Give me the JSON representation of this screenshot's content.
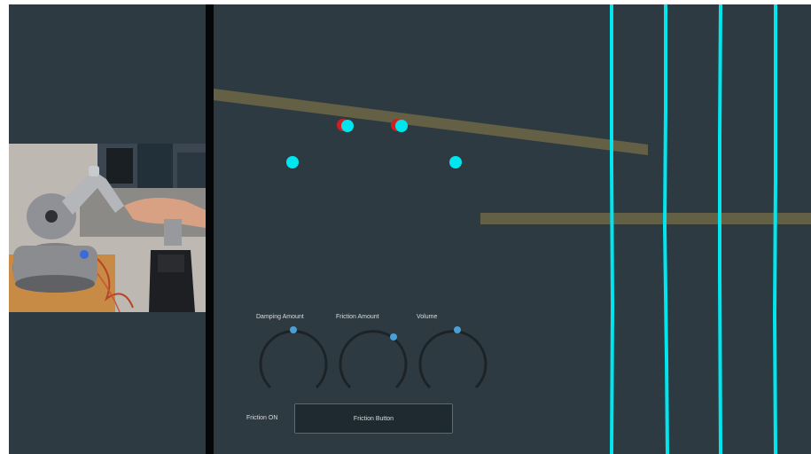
{
  "colors": {
    "background": "#2e3a41",
    "cursor_cyan": "#00e5ee",
    "ghost_red": "#d11f1f",
    "track_gold": "#6a6547",
    "knob_track": "#1c2327",
    "knob_accent": "#4a9fd6"
  },
  "video": {
    "description_icon": "haptic-device-camera-feed"
  },
  "knobs": [
    {
      "label": "Damping Amount",
      "value": 0.5
    },
    {
      "label": "Friction Amount",
      "value": 0.7
    },
    {
      "label": "Volume",
      "value": 0.55
    }
  ],
  "friction": {
    "status_label": "Friction ON",
    "button_label": "Friction Button"
  }
}
